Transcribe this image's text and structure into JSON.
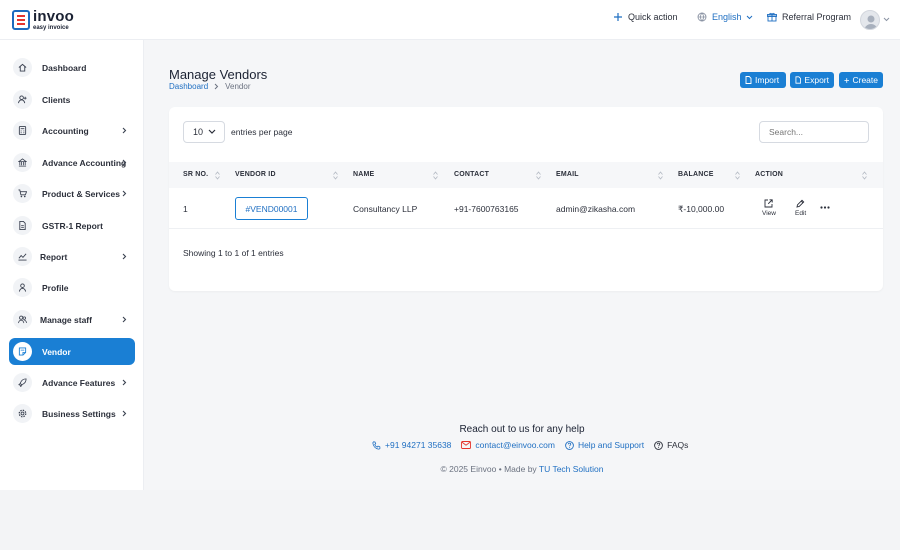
{
  "brand": {
    "name": "invoo",
    "tagline": "easy invoice"
  },
  "header": {
    "quick_action": "Quick action",
    "language": "English",
    "referral": "Referral Program"
  },
  "sidebar": {
    "items": [
      {
        "label": "Dashboard",
        "icon": "home-icon",
        "caret": false
      },
      {
        "label": "Clients",
        "icon": "user-plus-icon",
        "caret": false
      },
      {
        "label": "Accounting",
        "icon": "calculator-icon",
        "caret": true
      },
      {
        "label": "Advance Accounting",
        "icon": "bank-icon",
        "caret": true
      },
      {
        "label": "Product & Services",
        "icon": "cart-icon",
        "caret": true
      },
      {
        "label": "GSTR-1 Report",
        "icon": "document-icon",
        "caret": false
      },
      {
        "label": "Report",
        "icon": "chart-line-icon",
        "caret": true
      },
      {
        "label": "Profile",
        "icon": "user-icon",
        "caret": false
      },
      {
        "label": "Manage staff",
        "icon": "users-icon",
        "caret": true
      },
      {
        "label": "Vendor",
        "icon": "vendor-icon",
        "caret": false,
        "active": true
      },
      {
        "label": "Advance Features",
        "icon": "rocket-icon",
        "caret": true
      },
      {
        "label": "Business Settings",
        "icon": "gear-icon",
        "caret": true
      }
    ]
  },
  "page": {
    "title": "Manage Vendors",
    "breadcrumb": {
      "home": "Dashboard",
      "current": "Vendor"
    },
    "buttons": {
      "import": "Import",
      "export": "Export",
      "create": "Create"
    }
  },
  "table": {
    "entries_value": "10",
    "entries_label": "entries per page",
    "search_placeholder": "Search...",
    "columns": [
      "SR NO.",
      "VENDOR ID",
      "NAME",
      "CONTACT",
      "EMAIL",
      "BALANCE",
      "ACTION"
    ],
    "rows": [
      {
        "sr": "1",
        "vendor_id": "#VEND00001",
        "name": "Consultancy LLP",
        "contact": "+91-7600763165",
        "email": "admin@zikasha.com",
        "balance": "₹-10,000.00"
      }
    ],
    "actions": {
      "view": "View",
      "edit": "Edit"
    },
    "showing": "Showing 1 to 1 of 1 entries"
  },
  "footer": {
    "help_title": "Reach out to us for any help",
    "phone": "+91 94271 35638",
    "email": "contact@einvoo.com",
    "support": "Help and Support",
    "faqs": "FAQs",
    "copyright_prefix": "© 2025 Einvoo  •  Made by ",
    "maker": "TU Tech Solution"
  },
  "colors": {
    "primary": "#1a7fd4",
    "logo_red": "#e5352e",
    "logo_blue": "#1d6bbf"
  }
}
